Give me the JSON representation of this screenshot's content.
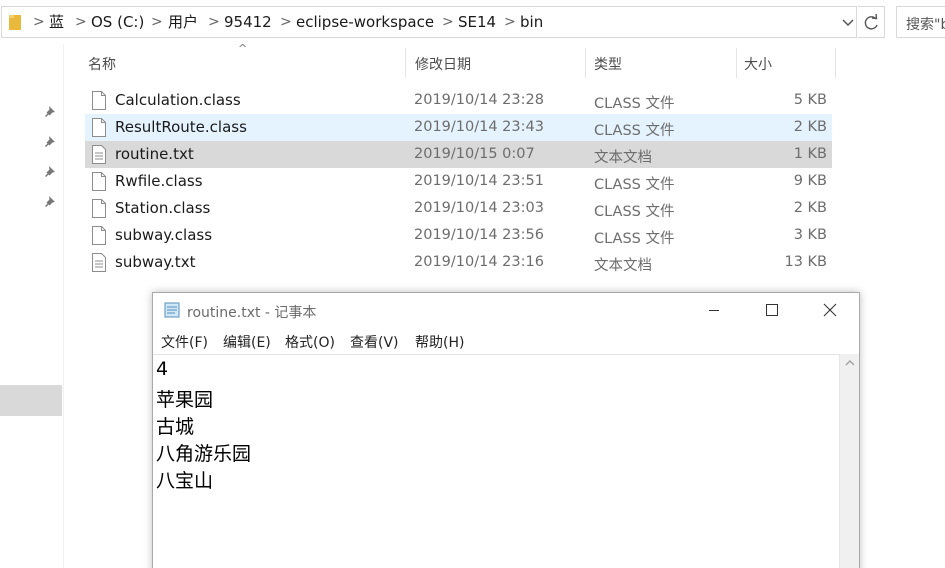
{
  "address": {
    "crumbs": [
      "蓝",
      "OS (C:)",
      "用户",
      "95412",
      "eclipse-workspace",
      "SE14",
      "bin"
    ],
    "separator": ">",
    "search_placeholder": "搜索\"b"
  },
  "columns": {
    "name": "名称",
    "date": "修改日期",
    "type": "类型",
    "size": "大小"
  },
  "files": [
    {
      "name": "Calculation.class",
      "date": "2019/10/14 23:28",
      "type": "CLASS 文件",
      "size": "5 KB",
      "icon": "file-icon"
    },
    {
      "name": "ResultRoute.class",
      "date": "2019/10/14 23:43",
      "type": "CLASS 文件",
      "size": "2 KB",
      "icon": "file-icon"
    },
    {
      "name": "routine.txt",
      "date": "2019/10/15 0:07",
      "type": "文本文档",
      "size": "1 KB",
      "icon": "text-file-icon"
    },
    {
      "name": "Rwfile.class",
      "date": "2019/10/14 23:51",
      "type": "CLASS 文件",
      "size": "9 KB",
      "icon": "file-icon"
    },
    {
      "name": "Station.class",
      "date": "2019/10/14 23:03",
      "type": "CLASS 文件",
      "size": "2 KB",
      "icon": "file-icon"
    },
    {
      "name": "subway.class",
      "date": "2019/10/14 23:56",
      "type": "CLASS 文件",
      "size": "3 KB",
      "icon": "file-icon"
    },
    {
      "name": "subway.txt",
      "date": "2019/10/14 23:16",
      "type": "文本文档",
      "size": "13 KB",
      "icon": "text-file-icon"
    }
  ],
  "notepad": {
    "title": "routine.txt - 记事本",
    "menu": [
      "文件(F)",
      "编辑(E)",
      "格式(O)",
      "查看(V)",
      "帮助(H)"
    ],
    "lines": [
      "4",
      "苹果园",
      "古城",
      "八角游乐园",
      "八宝山"
    ]
  },
  "colors": {
    "hover_row": "#e5f3ff",
    "selected_row": "#d9d9d9",
    "folder": "#e8b93a"
  }
}
